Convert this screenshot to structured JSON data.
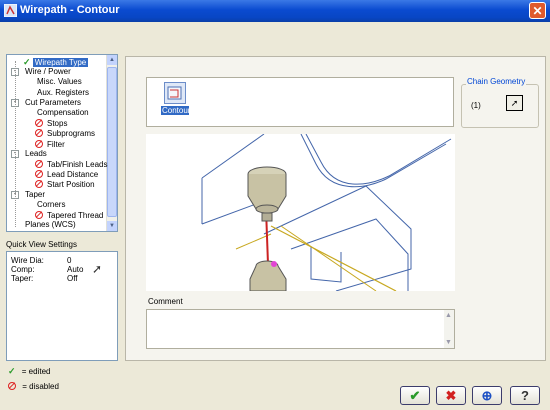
{
  "window": {
    "title": "Wirepath - Contour"
  },
  "tree": {
    "items": [
      {
        "label": "Wirepath Type",
        "level": 1,
        "status": "edited",
        "selected": true
      },
      {
        "label": "Wire / Power",
        "level": 1,
        "status": "none",
        "expander": "-"
      },
      {
        "label": "Misc. Values",
        "level": 2,
        "status": "none"
      },
      {
        "label": "Aux. Registers",
        "level": 2,
        "status": "none"
      },
      {
        "label": "Cut Parameters",
        "level": 1,
        "status": "none",
        "expander": "-"
      },
      {
        "label": "Compensation",
        "level": 2,
        "status": "none"
      },
      {
        "label": "Stops",
        "level": 2,
        "status": "disabled"
      },
      {
        "label": "Subprograms",
        "level": 2,
        "status": "disabled"
      },
      {
        "label": "Filter",
        "level": 2,
        "status": "disabled"
      },
      {
        "label": "Leads",
        "level": 1,
        "status": "none",
        "expander": "-"
      },
      {
        "label": "Tab/Finish Leads",
        "level": 2,
        "status": "disabled"
      },
      {
        "label": "Lead Distance",
        "level": 2,
        "status": "disabled"
      },
      {
        "label": "Start Position",
        "level": 2,
        "status": "disabled"
      },
      {
        "label": "Taper",
        "level": 1,
        "status": "none",
        "expander": "-"
      },
      {
        "label": "Corners",
        "level": 2,
        "status": "none"
      },
      {
        "label": "Tapered Thread",
        "level": 2,
        "status": "disabled"
      },
      {
        "label": "Planes (WCS)",
        "level": 1,
        "status": "none"
      }
    ]
  },
  "quick_view": {
    "label": "Quick View Settings",
    "rows": [
      {
        "key": "Wire Dia:",
        "value": "0"
      },
      {
        "key": "Comp:",
        "value": "Auto"
      },
      {
        "key": "Taper:",
        "value": "Off"
      }
    ]
  },
  "wirepath_types": {
    "items": [
      {
        "label": "Contour",
        "icon": "contour-icon"
      }
    ]
  },
  "chain_geometry": {
    "title": "Chain Geometry",
    "count": "(1)",
    "button_icon": "select-arrow-icon"
  },
  "comment": {
    "label": "Comment",
    "value": ""
  },
  "legend": {
    "edited": "= edited",
    "disabled": "= disabled"
  },
  "buttons": [
    {
      "name": "ok-button",
      "icon": "checkmark-icon",
      "color": "#2a9a2a"
    },
    {
      "name": "cancel-button",
      "icon": "x-icon",
      "color": "#d22020"
    },
    {
      "name": "add-button",
      "icon": "plus-icon",
      "color": "#1c4fc4"
    },
    {
      "name": "help-button",
      "icon": "question-icon",
      "color": "#333333"
    }
  ],
  "colors": {
    "titlebar": "#0a4bd0",
    "selection": "#316ac5",
    "edited": "#2a9a2a",
    "disabled": "#d22020"
  }
}
